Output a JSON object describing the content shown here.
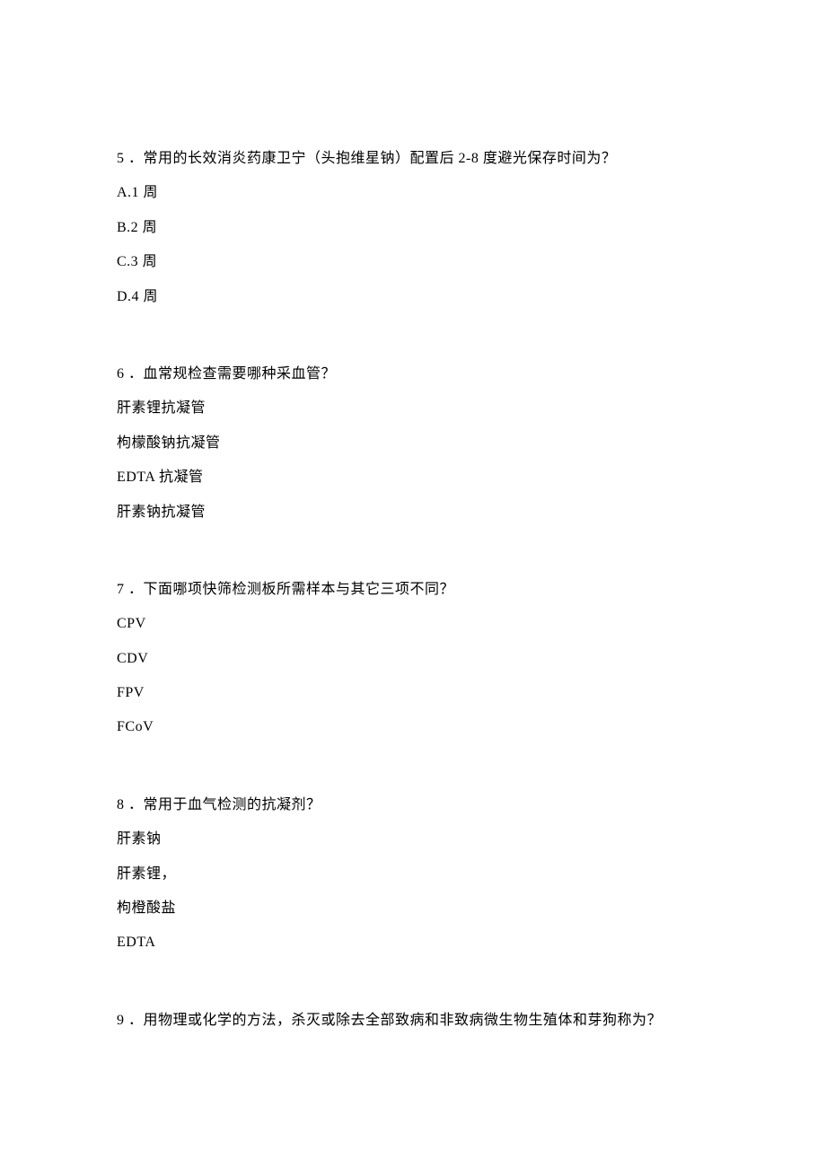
{
  "questions": [
    {
      "number": "5",
      "text": "．常用的长效消炎药康卫宁（头抱维星钠）配置后 2-8 度避光保存时间为？",
      "options": [
        "A.1 周",
        "B.2 周",
        "C.3 周",
        "D.4 周"
      ]
    },
    {
      "number": "6",
      "text": "．血常规检查需要哪种采血管？",
      "options": [
        "肝素锂抗凝管",
        "枸檬酸钠抗凝管",
        "EDTA 抗凝管",
        "肝素钠抗凝管"
      ]
    },
    {
      "number": "7",
      "text": "．下面哪项快筛检测板所需样本与其它三项不同？",
      "options": [
        "CPV",
        "CDV",
        "FPV",
        "FCoV"
      ]
    },
    {
      "number": "8",
      "text": "．常用于血气检测的抗凝剂？",
      "options": [
        "肝素钠",
        "肝素锂，",
        "枸橙酸盐",
        "EDTA"
      ]
    },
    {
      "number": "9",
      "text": "．用物理或化学的方法，杀灭或除去全部致病和非致病微生物生殖体和芽狗称为？",
      "options": []
    }
  ]
}
